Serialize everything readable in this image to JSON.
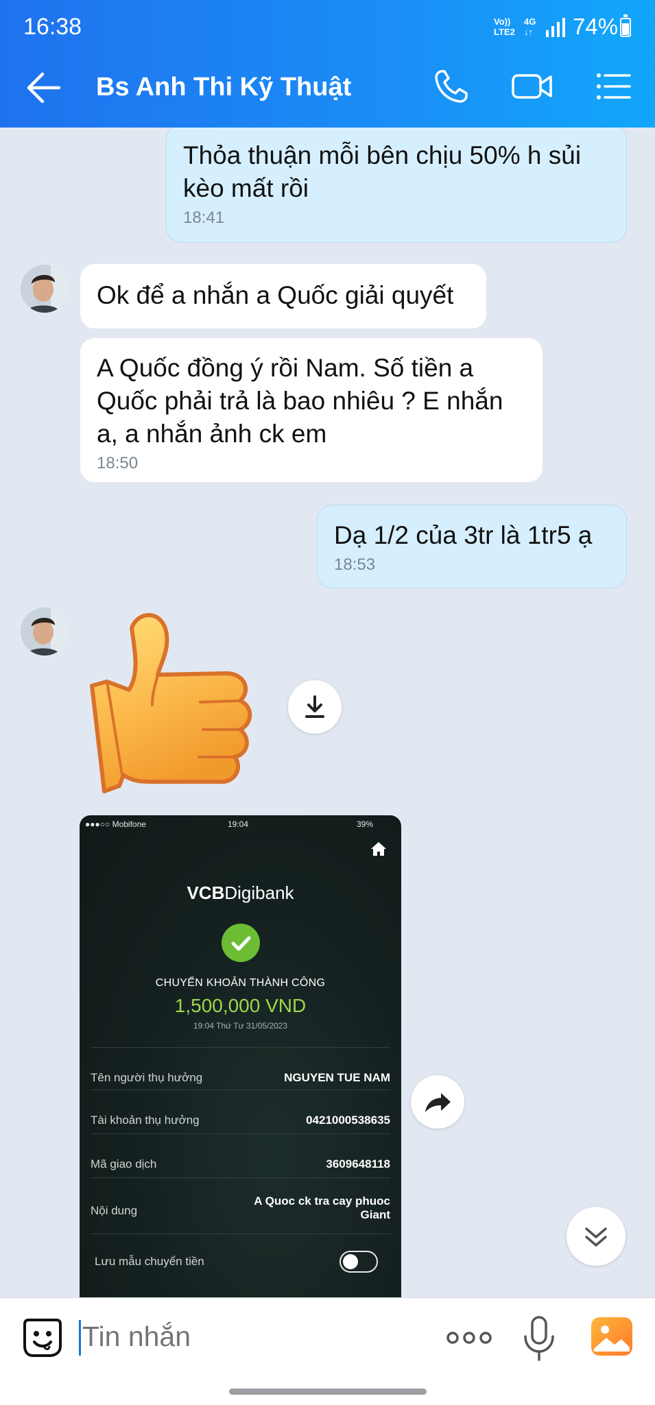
{
  "status_bar": {
    "time": "16:38",
    "network_line1": "Vo))",
    "network_line2": "LTE2",
    "network_type": "4G",
    "network_arrows": "↓↑",
    "battery": "74%"
  },
  "header": {
    "title": "Bs Anh Thi Kỹ Thuật",
    "icons": [
      "back-arrow-icon",
      "phone-icon",
      "video-call-icon",
      "menu-list-icon"
    ]
  },
  "messages": [
    {
      "side": "out",
      "text": "Thỏa thuận mỗi bên chịu 50% h sủi kèo mất rồi",
      "time": "18:41"
    },
    {
      "side": "in",
      "text": "Ok để a nhắn a Quốc giải quyết",
      "time": ""
    },
    {
      "side": "in",
      "text": "A Quốc đồng ý rồi Nam. Số tiền a Quốc phải trả là bao nhiêu ? E nhắn a, a nhắn ảnh ck em",
      "time": "18:50"
    },
    {
      "side": "out",
      "text": "Dạ 1/2 của 3tr là 1tr5 ạ",
      "time": "18:53"
    }
  ],
  "sticker": {
    "name": "thumbs-up-sticker"
  },
  "receipt": {
    "carrier": "●●●○○ Mobifone",
    "time": "19:04",
    "battery": "39%",
    "brand_bold": "VCB",
    "brand_rest": "Digibank",
    "status": "CHUYỂN KHOẢN THÀNH CÔNG",
    "amount": "1,500,000 VND",
    "datetime": "19:04 Thứ Tư 31/05/2023",
    "rows": [
      {
        "label": "Tên người thụ hưởng",
        "value": "NGUYEN TUE NAM"
      },
      {
        "label": "Tài khoản thụ hưởng",
        "value": "0421000538635"
      },
      {
        "label": "Mã giao dịch",
        "value": "3609648118"
      },
      {
        "label": "Nội dung",
        "value": "A Quoc ck tra cay phuoc",
        "value2": "Giant"
      },
      {
        "label": "Lưu mẫu chuyển tiền",
        "value": ""
      }
    ]
  },
  "input": {
    "placeholder": "Tin nhắn",
    "icons": [
      "emoji-icon",
      "more-options-icon",
      "microphone-icon",
      "image-icon"
    ]
  },
  "colors": {
    "header_start": "#1f72ee",
    "header_end": "#12a7fb",
    "chat_bg": "#e2e8f1",
    "outgoing_bubble": "#d6efff",
    "incoming_bubble": "#ffffff",
    "receipt_accent": "#9ed84a"
  }
}
